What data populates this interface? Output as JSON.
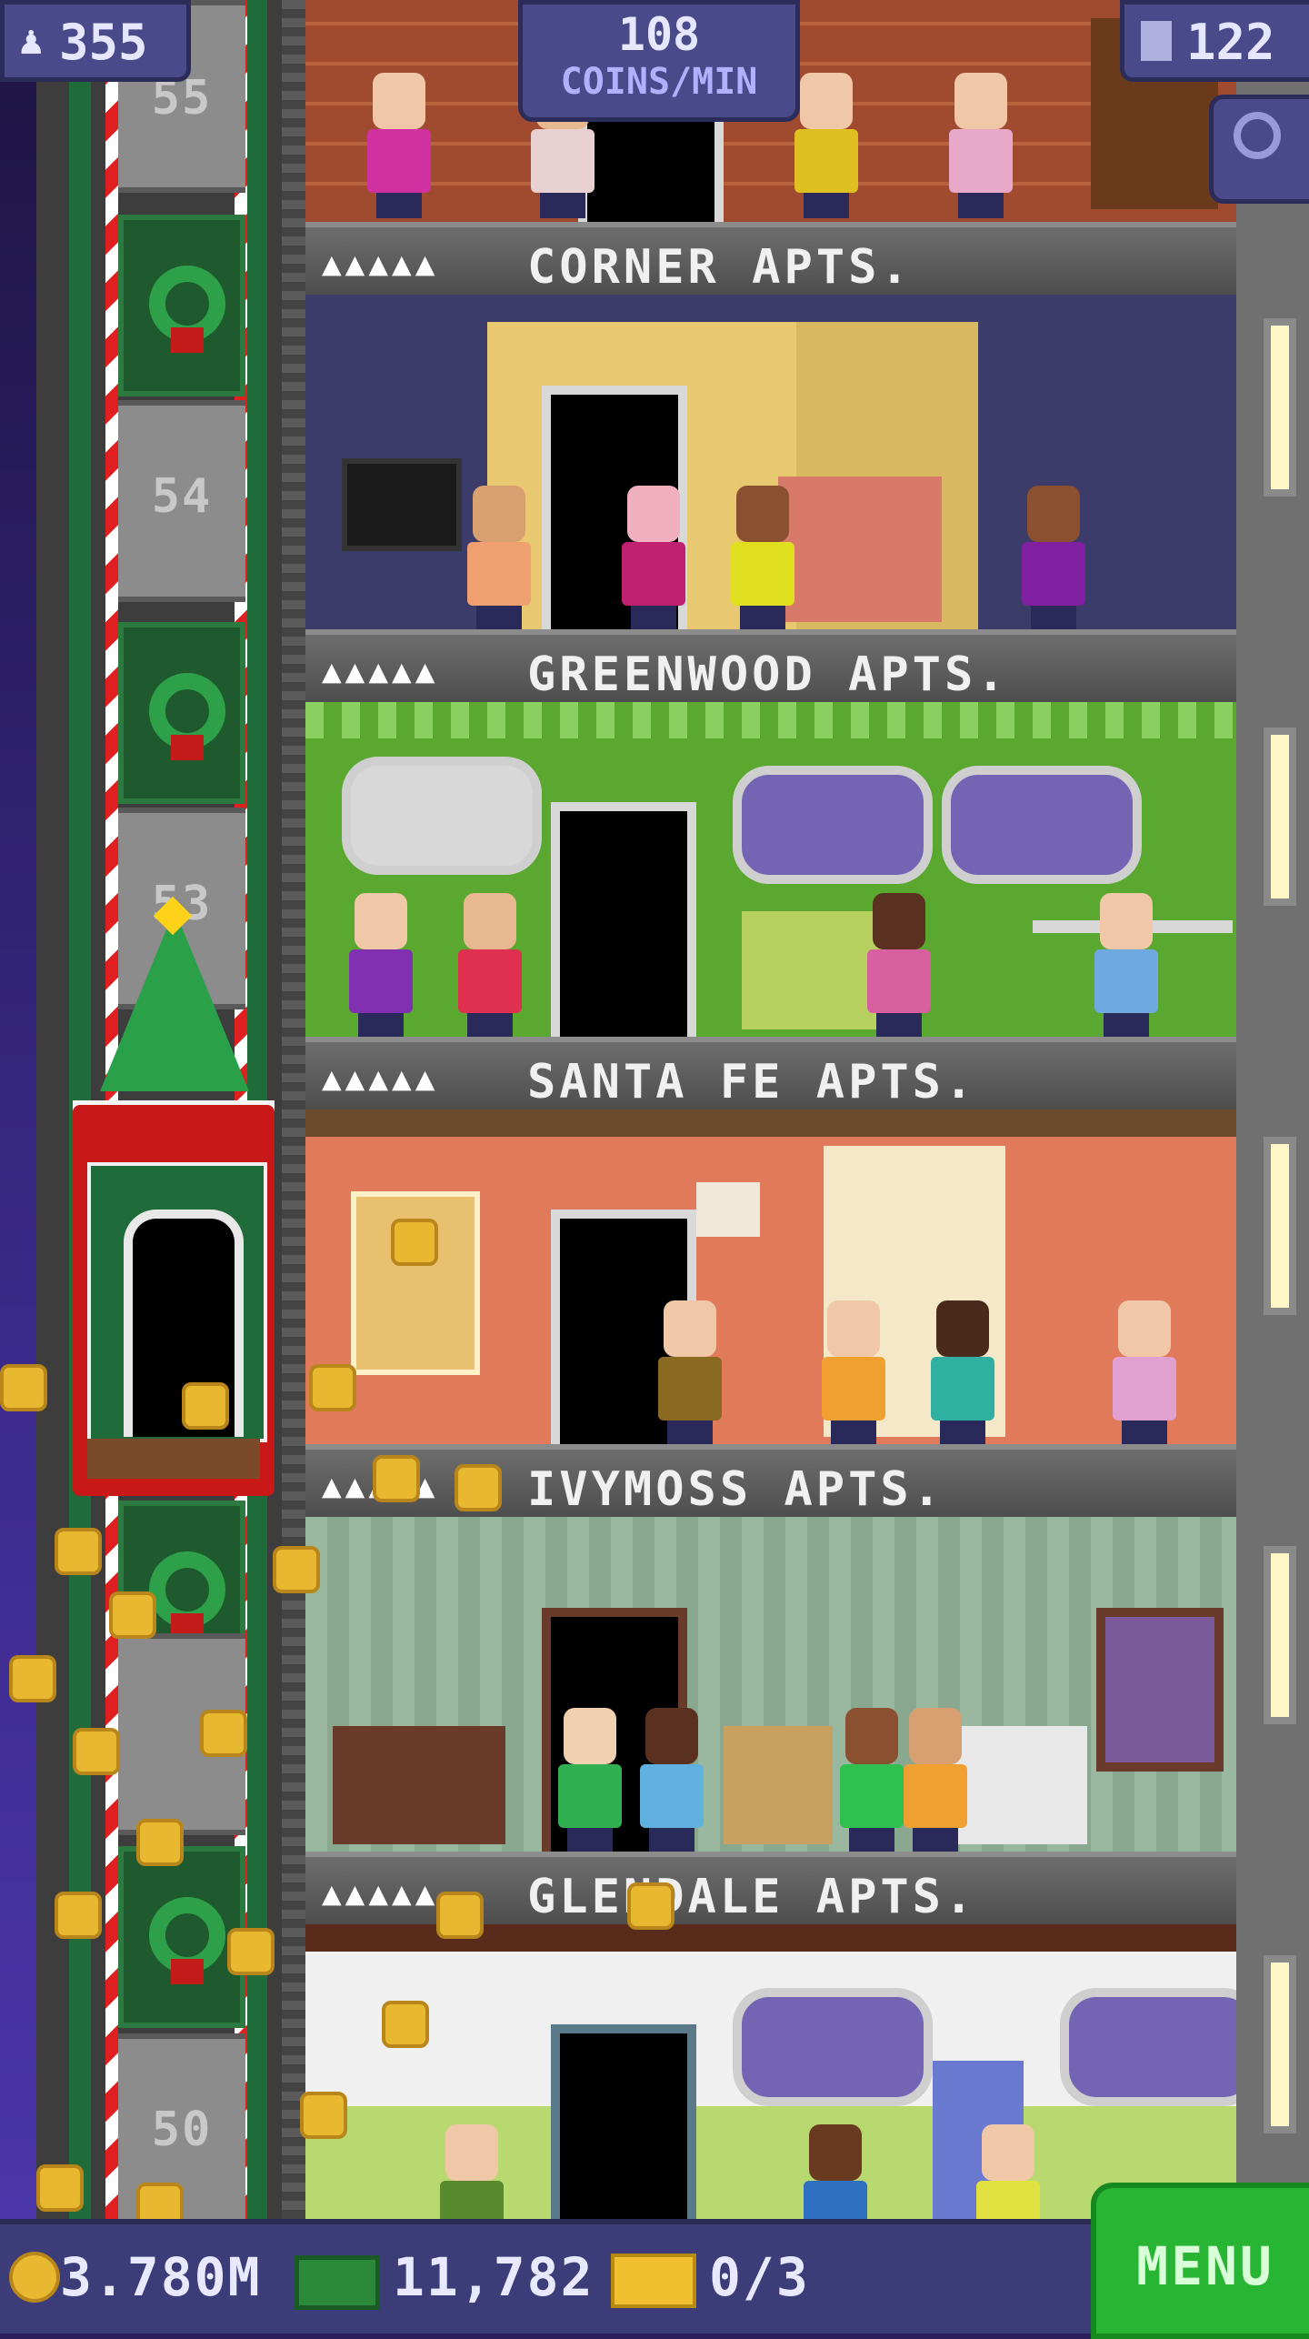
{
  "hud": {
    "population": "355",
    "coins_per_min_value": "108",
    "coins_per_min_label": "COINS/MIN",
    "floor_count": "122",
    "coins": "3.780M",
    "bux": "11,782",
    "tickets": "0/3",
    "menu_label": "MENU"
  },
  "elevator": {
    "floor_numbers": [
      "55",
      "54",
      "53",
      "50"
    ]
  },
  "floors": [
    {
      "name": "CORNER APTS.",
      "rating": "▲▲▲▲▲"
    },
    {
      "name": "GREENWOOD APTS.",
      "rating": "▲▲▲▲▲"
    },
    {
      "name": "SANTA FE APTS.",
      "rating": "▲▲▲▲▲"
    },
    {
      "name": "IVYMOSS APTS.",
      "rating": "▲▲▲▲▲"
    },
    {
      "name": "GLENDALE APTS.",
      "rating": "▲▲▲▲▲"
    }
  ],
  "icons": {
    "population": "person-icon",
    "floors": "building-icon",
    "search": "magnifier-icon",
    "coins": "coin-icon",
    "bux": "bux-bill-icon",
    "tickets": "golden-ticket-icon"
  },
  "colors": {
    "menu_green": "#27b533",
    "hud_purple": "#4a4a8a",
    "christmas_red": "#c81818"
  }
}
